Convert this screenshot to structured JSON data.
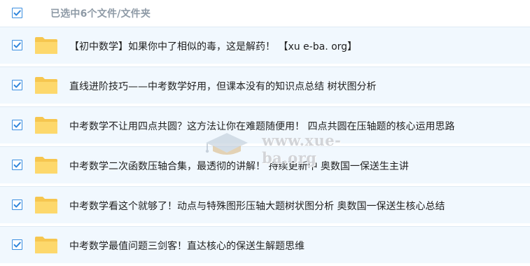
{
  "header": {
    "selection_label": "已选中6个文件/文件夹",
    "checked": true
  },
  "files": [
    {
      "name": "【初中数学】如果你中了相似的毒，这是解药！ 【xu e-ba. org】",
      "checked": true,
      "icon": "folder-icon"
    },
    {
      "name": "直线进阶技巧——中考数学好用，但课本没有的知识点总结 树状图分析",
      "checked": true,
      "icon": "folder-icon"
    },
    {
      "name": "中考数学不让用四点共圆？这方法让你在难题随便用！ 四点共圆在压轴题的核心运用思路",
      "checked": true,
      "icon": "folder-icon"
    },
    {
      "name": "中考数学二次函数压轴合集，最透彻的讲解！ 持续更新中 奥数国一保送生主讲",
      "checked": true,
      "icon": "folder-icon"
    },
    {
      "name": "中考数学看这个就够了！动点与特殊图形压轴大题树状图分析 奥数国一保送生核心总结",
      "checked": true,
      "icon": "folder-icon"
    },
    {
      "name": "中考数学最值问题三剑客！直达核心的保送生解题思维",
      "checked": true,
      "icon": "folder-icon"
    }
  ],
  "watermark": {
    "text": "www.xue-ba.org"
  },
  "colors": {
    "accent": "#3a8ee0",
    "row_bg": "#f1f8fe",
    "folder": "#fcd66a"
  }
}
